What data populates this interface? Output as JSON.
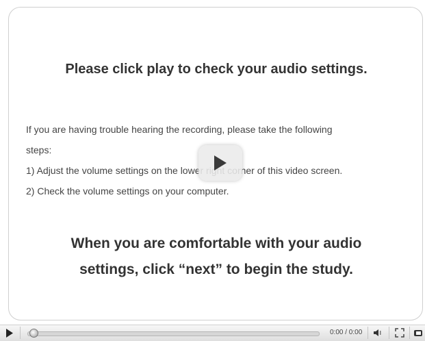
{
  "content": {
    "title": "Please click play to check your audio settings.",
    "instructions": [
      "If you are having trouble hearing the recording, please take the following",
      "steps:",
      "1) Adjust the volume settings on the lower right corner of this video screen.",
      "2) Check the volume settings on your computer."
    ],
    "closing": [
      "When you are comfortable with your audio",
      "settings, click “next” to begin the study."
    ]
  },
  "player": {
    "time_display": "0:00 / 0:00",
    "progress": 0,
    "icons": {
      "play": "play-icon",
      "overlay_play": "play-icon",
      "seek": "seek-knob",
      "volume": "volume-icon",
      "fullscreen": "fullscreen-icon",
      "popout": "popout-icon"
    }
  }
}
